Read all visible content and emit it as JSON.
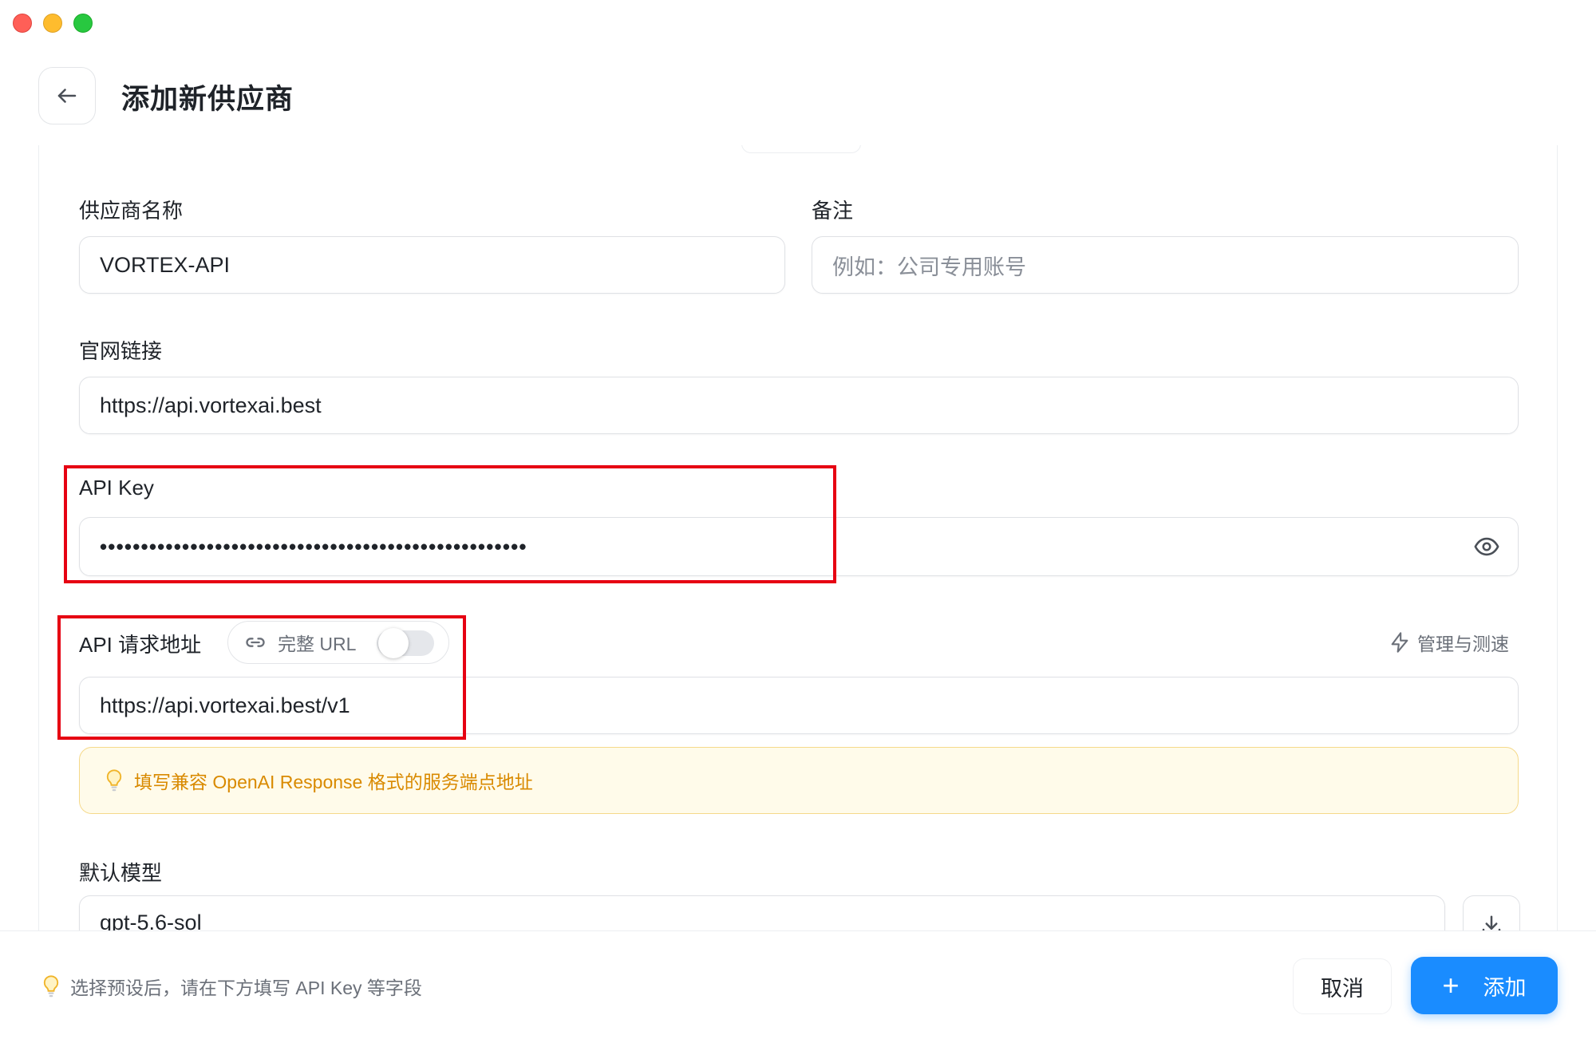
{
  "header": {
    "title": "添加新供应商"
  },
  "form": {
    "provider_name": {
      "label": "供应商名称",
      "value": "VORTEX-API"
    },
    "notes": {
      "label": "备注",
      "placeholder": "例如：公司专用账号"
    },
    "website": {
      "label": "官网链接",
      "value": "https://api.vortexai.best"
    },
    "api_key": {
      "label": "API Key",
      "masked_value": "••••••••••••••••••••••••••••••••••••••••••••••••••••"
    },
    "api_endpoint": {
      "label": "API 请求地址",
      "full_url_toggle_label": "完整 URL",
      "full_url_enabled": false,
      "manage_label": "管理与测速",
      "value": "https://api.vortexai.best/v1",
      "hint": "填写兼容 OpenAI Response 格式的服务端点地址"
    },
    "default_model": {
      "label": "默认模型",
      "value": "gpt-5.6-sol"
    }
  },
  "footer": {
    "hint": "选择预设后，请在下方填写 API Key 等字段",
    "cancel_label": "取消",
    "add_label": "添加"
  },
  "colors": {
    "primary": "#1a8cff",
    "hint_text": "#d98a00",
    "hint_bg": "#fffbea",
    "annotation_red": "#e60012"
  }
}
